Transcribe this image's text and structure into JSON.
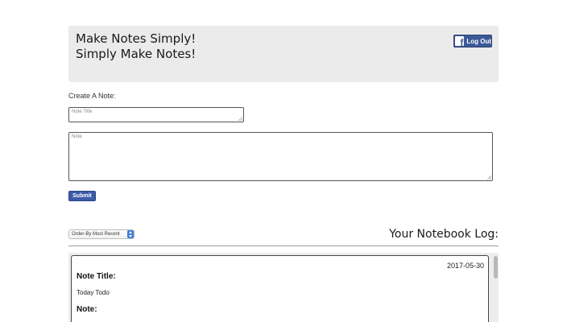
{
  "header": {
    "tagline_line1": "Make Notes Simply!",
    "tagline_line2": "Simply Make Notes!",
    "logout_label": "Log Out",
    "logout_icon": "facebook-icon"
  },
  "create_form": {
    "label": "Create A Note:",
    "title_placeholder": "Note Title",
    "note_placeholder": "Note",
    "submit_label": "Submit"
  },
  "log": {
    "sort_selected": "Order-By Most Recent",
    "heading": "Your Notebook Log:",
    "notes": [
      {
        "date": "2017-05-30",
        "title_label": "Note Title:",
        "title": "Today Todo",
        "note_label": "Note:"
      }
    ]
  },
  "colors": {
    "header_bg": "#ebebeb",
    "facebook_blue": "#3b5998",
    "submit_blue": "#3b5ba8",
    "log_panel_bg": "#ededed"
  }
}
